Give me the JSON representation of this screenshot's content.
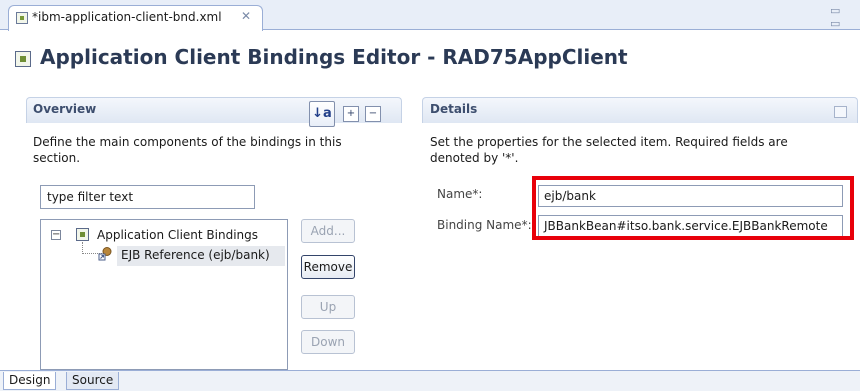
{
  "editor_tab": {
    "label": "*ibm-application-client-bnd.xml",
    "close_glyph": "✕"
  },
  "window_controls": "▭ ▭",
  "header": {
    "title": "Application Client Bindings Editor - RAD75AppClient"
  },
  "overview": {
    "title": "Overview",
    "description": "Define the main components of the bindings in this section.",
    "filter_text": "type filter text",
    "tree": {
      "root": {
        "label": "Application Client Bindings",
        "expanded": true
      },
      "children": [
        {
          "label": "EJB Reference (ejb/bank)",
          "selected": true
        }
      ]
    },
    "buttons": {
      "add": "Add...",
      "remove": "Remove",
      "up": "Up",
      "down": "Down"
    }
  },
  "details": {
    "title": "Details",
    "description": "Set the properties for the selected item. Required fields are denoted by '*'.",
    "fields": {
      "name_label": "Name*:",
      "name_value": "ejb/bank",
      "binding_label": "Binding Name*:",
      "binding_value": "JBBankBean#itso.bank.service.EJBBankRemote"
    }
  },
  "bottom_tabs": [
    "Design",
    "Source"
  ],
  "colors": {
    "highlight": "#e8000a",
    "accent": "#2b3a55"
  }
}
